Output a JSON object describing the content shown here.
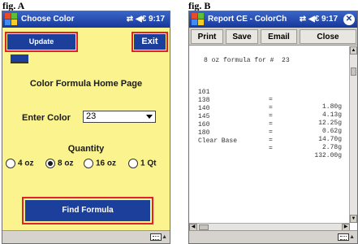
{
  "fig_a": {
    "label": "fig. A",
    "titlebar": {
      "title": "Choose Color",
      "status": "⇄ ◀€ 9:17"
    },
    "buttons": {
      "update": "Update",
      "exit": "Exit",
      "find": "Find Formula"
    },
    "heading": "Color Formula Home Page",
    "enter_color": {
      "label": "Enter Color",
      "value": "23"
    },
    "quantity": {
      "label": "Quantity",
      "options": [
        "4 oz",
        "8 oz",
        "16 oz",
        "1 Qt"
      ],
      "selected": "8 oz"
    },
    "highlight_color": "#e0222a"
  },
  "fig_b": {
    "label": "fig. B",
    "titlebar": {
      "title": "Report CE - ColorCh",
      "status": "⇄ ◀€ 9:17",
      "ok": "✕"
    },
    "toolbar": [
      "Print",
      "Save",
      "Email",
      "Close"
    ],
    "report": {
      "heading": "8 oz formula for #  23",
      "rows": [
        {
          "code": "101",
          "eq": "=",
          "amount": "1.80g"
        },
        {
          "code": "138",
          "eq": "=",
          "amount": "4.13g"
        },
        {
          "code": "140",
          "eq": "=",
          "amount": "12.25g"
        },
        {
          "code": "145",
          "eq": "=",
          "amount": "0.62g"
        },
        {
          "code": "160",
          "eq": "=",
          "amount": "14.70g"
        },
        {
          "code": "180",
          "eq": "=",
          "amount": "2.78g"
        },
        {
          "code": "Clear Base",
          "eq": "=",
          "amount": "132.00g"
        }
      ]
    }
  },
  "colors": {
    "screen_bg_a": "#fbf38d",
    "titlebar": "#17389a",
    "button": "#1c3f9c"
  }
}
